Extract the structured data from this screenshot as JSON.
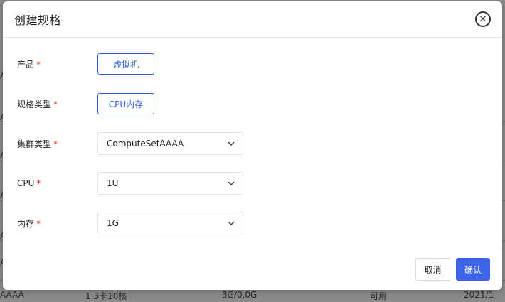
{
  "background": {
    "fragments": [
      "A",
      "A",
      "A",
      "A",
      "A",
      "A",
      "AAAA",
      "1.3卡10核",
      "3G/0.0G",
      "可用",
      "2021/1"
    ]
  },
  "modal": {
    "title": "创建规格",
    "close_icon": "close-circle-icon"
  },
  "form": {
    "product": {
      "label": "产品",
      "required_mark": "*",
      "value": "虚拟机"
    },
    "spec_type": {
      "label": "规格类型",
      "required_mark": "*",
      "value": "CPU内存"
    },
    "cluster_type": {
      "label": "集群类型",
      "required_mark": "*",
      "value": "ComputeSetAAAA"
    },
    "cpu": {
      "label": "CPU",
      "required_mark": "*",
      "value": "1U"
    },
    "memory": {
      "label": "内存",
      "required_mark": "*",
      "value": "1G"
    }
  },
  "footer": {
    "cancel_label": "取消",
    "confirm_label": "确认"
  },
  "colors": {
    "primary": "#3d63e6",
    "outline_blue": "#2c5fd6",
    "required": "#e02424",
    "overlay": "#8a8a8a"
  }
}
